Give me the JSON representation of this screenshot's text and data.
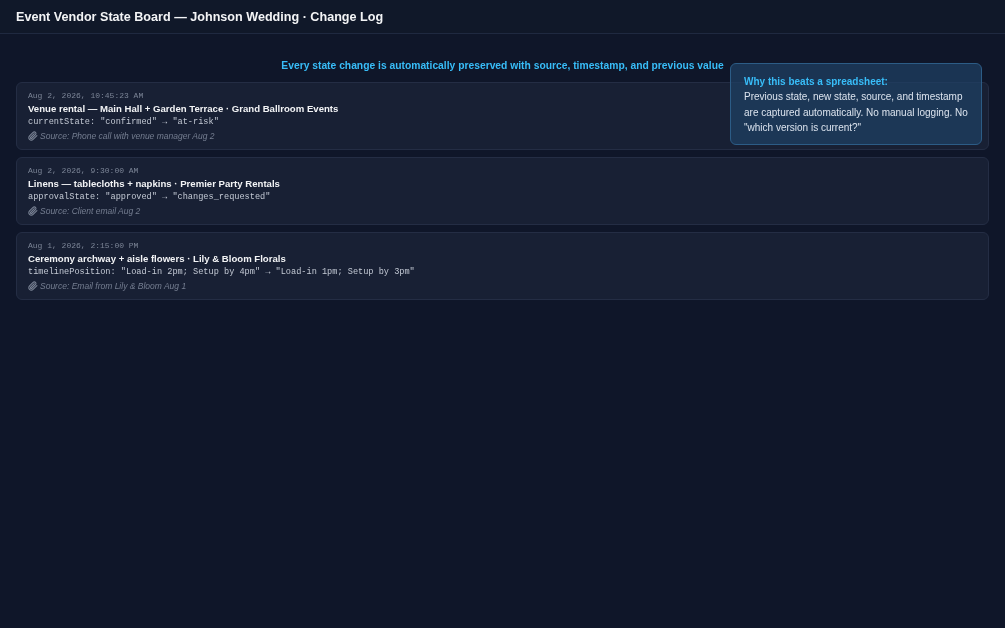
{
  "header": {
    "title": "Event Vendor State Board — Johnson Wedding · Change Log"
  },
  "banner": "Every state change is automatically preserved with source, timestamp, and previous value",
  "callout": {
    "title": "Why this beats a spreadsheet:",
    "body": "Previous state, new state, source, and timestamp are captured automatically. No manual logging. No \"which version is current?\""
  },
  "changes": [
    {
      "timestamp": "Aug 2, 2026, 10:45:23 AM",
      "item": "Venue rental — Main Hall + Garden Terrace · Grand Ballroom Events",
      "change": "currentState: \"confirmed\" → \"at-risk\"",
      "source": "Source: Phone call with venue manager Aug 2"
    },
    {
      "timestamp": "Aug 2, 2026, 9:30:00 AM",
      "item": "Linens — tablecloths + napkins · Premier Party Rentals",
      "change": "approvalState: \"approved\" → \"changes_requested\"",
      "source": "Source: Client email Aug 2"
    },
    {
      "timestamp": "Aug 1, 2026, 2:15:00 PM",
      "item": "Ceremony archway + aisle flowers · Lily & Bloom Florals",
      "change": "timelinePosition: \"Load-in 2pm; Setup by 4pm\" → \"Load-in 1pm; Setup by 3pm\"",
      "source": "Source: Email from Lily & Bloom Aug 1"
    }
  ]
}
